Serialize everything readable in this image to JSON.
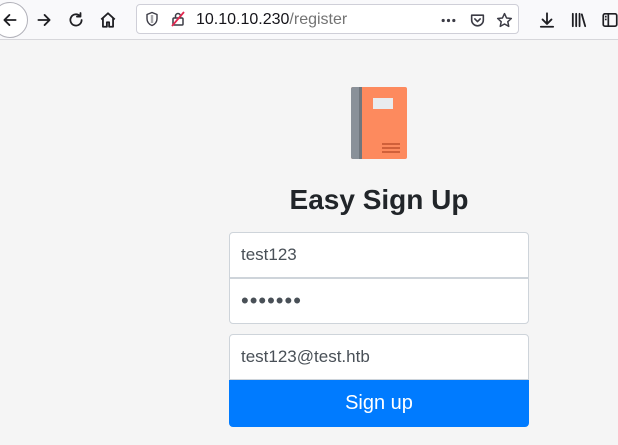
{
  "browser": {
    "url_host": "10.10.10.230",
    "url_path": "/register",
    "icons": [
      "back-icon",
      "forward-icon",
      "reload-icon",
      "home-icon",
      "tracking-shield-icon",
      "insecure-lock-icon",
      "page-actions-icon",
      "pocket-icon",
      "bookmark-star-icon",
      "downloads-icon",
      "library-icon",
      "sidebar-icon"
    ]
  },
  "page": {
    "logo_icon": "notebook-icon",
    "title": "Easy Sign Up",
    "username_value": "test123",
    "password_mask": "•••••••",
    "email_value": "test123@test.htb",
    "signup_label": "Sign up"
  },
  "colors": {
    "primary": "#007bff",
    "notebook_orange": "#fd8a5e",
    "notebook_spine": "#8a9199"
  }
}
